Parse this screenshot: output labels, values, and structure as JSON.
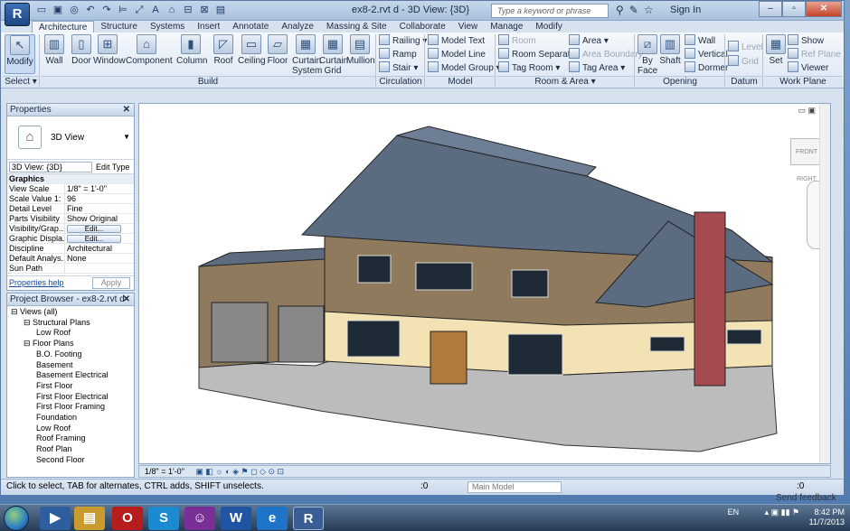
{
  "window": {
    "title": "ex8-2.rvt d - 3D View: {3D}",
    "search_placeholder": "Type a keyword or phrase",
    "signin": "Sign In"
  },
  "tabs": [
    "Architecture",
    "Structure",
    "Systems",
    "Insert",
    "Annotate",
    "Analyze",
    "Massing & Site",
    "Collaborate",
    "View",
    "Manage",
    "Modify"
  ],
  "ribbon": {
    "select": {
      "modify": "Modify",
      "select": "Select ▾"
    },
    "build": {
      "label": "Build",
      "items": [
        "Wall",
        "Door",
        "Window",
        "Component",
        "Column",
        "Roof",
        "Ceiling",
        "Floor",
        "Curtain System",
        "Curtain Grid",
        "Mullion"
      ]
    },
    "circulation": {
      "label": "Circulation",
      "items": [
        "Railing ▾",
        "Ramp",
        "Stair ▾"
      ]
    },
    "model": {
      "label": "Model",
      "items": [
        "Model Text",
        "Model Line",
        "Model Group ▾"
      ]
    },
    "room_area": {
      "label": "Room & Area ▾",
      "items": [
        "Room",
        "Room Separator",
        "Tag Room ▾",
        "Area ▾",
        "Area Boundary",
        "Tag Area ▾"
      ]
    },
    "opening": {
      "label": "Opening",
      "items": [
        "By Face",
        "Shaft",
        "Wall",
        "Vertical",
        "Dormer"
      ]
    },
    "datum": {
      "label": "Datum",
      "items": [
        "Level",
        "Grid"
      ]
    },
    "workplane": {
      "label": "Work Plane",
      "items": [
        "Set",
        "Show",
        "Ref Plane",
        "Viewer"
      ]
    }
  },
  "properties": {
    "title": "Properties",
    "type_name": "3D View",
    "selector": "3D View: {3D}",
    "edit_type": "Edit Type",
    "section": "Graphics",
    "rows": [
      {
        "k": "View Scale",
        "v": "1/8\" = 1'-0\""
      },
      {
        "k": "Scale Value  1:",
        "v": "96"
      },
      {
        "k": "Detail Level",
        "v": "Fine"
      },
      {
        "k": "Parts Visibility",
        "v": "Show Original"
      },
      {
        "k": "Visibility/Grap...",
        "v": "Edit..."
      },
      {
        "k": "Graphic Displa...",
        "v": "Edit..."
      },
      {
        "k": "Discipline",
        "v": "Architectural"
      },
      {
        "k": "Default Analys...",
        "v": "None"
      },
      {
        "k": "Sun Path",
        "v": ""
      }
    ],
    "help": "Properties help",
    "apply": "Apply"
  },
  "browser": {
    "title": "Project Browser - ex8-2.rvt d",
    "items": [
      "Views (all)",
      "Structural Plans",
      "Low Roof",
      "Floor Plans",
      "B.O. Footing",
      "Basement",
      "Basement Electrical",
      "First Floor",
      "First Floor Electrical",
      "First Floor Framing",
      "Foundation",
      "Low Roof",
      "Roof Framing",
      "Roof Plan",
      "Second Floor"
    ]
  },
  "view": {
    "cube_front": "FRONT",
    "cube_right": "RIGHT",
    "scale": "1/8\" = 1'-0\""
  },
  "status": {
    "text": "Click to select, TAB for alternates, CTRL adds, SHIFT unselects.",
    "zero": ":0",
    "model": "Main Model",
    "filter": ":0"
  },
  "feedback": "Send feedback",
  "tray": {
    "lang": "EN",
    "time": "8:42 PM",
    "date": "11/7/2013"
  }
}
